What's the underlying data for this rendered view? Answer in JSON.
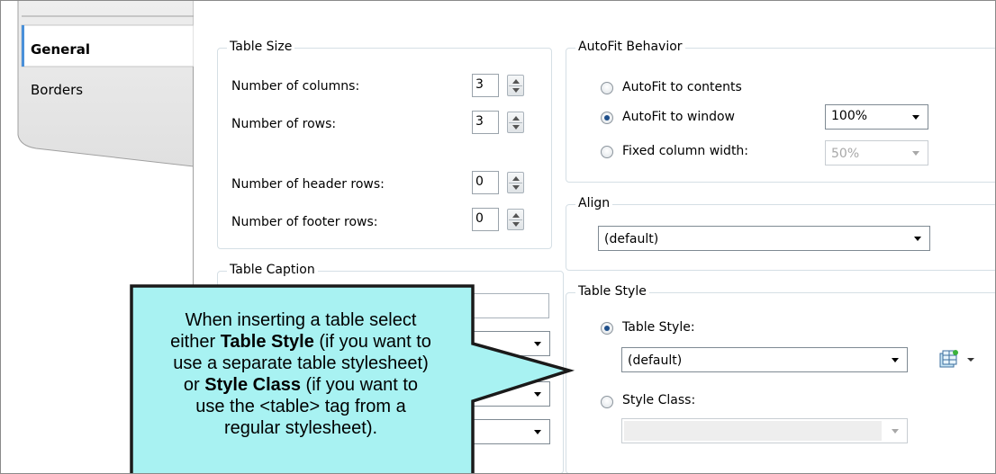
{
  "tabs": [
    {
      "label": "General",
      "selected": true
    },
    {
      "label": "Borders",
      "selected": false
    }
  ],
  "table_size": {
    "title": "Table Size",
    "columns_label": "Number of columns:",
    "columns_value": "3",
    "rows_label": "Number of rows:",
    "rows_value": "3",
    "header_rows_label": "Number of header rows:",
    "header_rows_value": "0",
    "footer_rows_label": "Number of footer rows:",
    "footer_rows_value": "0"
  },
  "autofit": {
    "title": "AutoFit Behavior",
    "option_contents": "AutoFit to contents",
    "option_window": "AutoFit to window",
    "option_fixed": "Fixed column width:",
    "selected": "window",
    "window_value": "100%",
    "fixed_value": "50%"
  },
  "align": {
    "title": "Align",
    "value": "(default)"
  },
  "table_caption": {
    "title": "Table Caption"
  },
  "table_style": {
    "title": "Table Style",
    "option_table_style": "Table Style:",
    "table_style_value": "(default)",
    "option_style_class": "Style Class:",
    "selected": "table_style"
  },
  "callout": {
    "line1": "When inserting a table select",
    "line2_pre": "either ",
    "line2_bold": "Table Style",
    "line2_post": " (if you want to",
    "line3": "use a separate table stylesheet)",
    "line4_pre": "or ",
    "line4_bold": "Style Class",
    "line4_post": " (if you want to",
    "line5": "use the <table> tag from a",
    "line6": "regular stylesheet).",
    "fill_color": "#a8f2f2",
    "border_color": "#1a1a1a"
  }
}
